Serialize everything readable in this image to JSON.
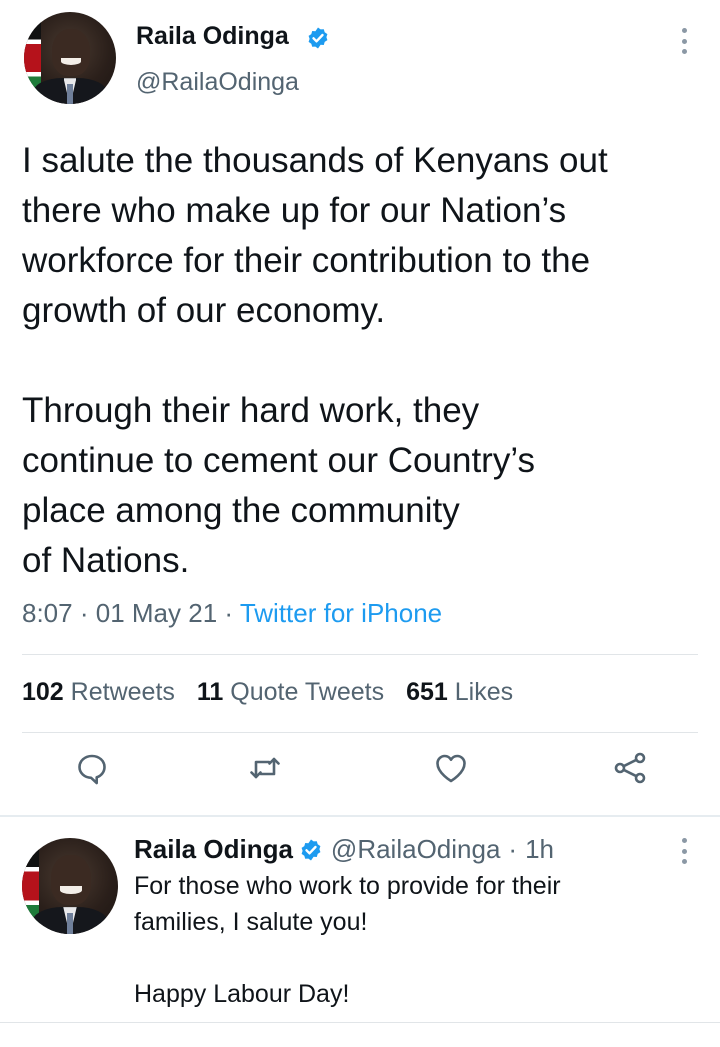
{
  "main_tweet": {
    "author_name": "Raila Odinga",
    "author_handle": "@RailaOdinga",
    "text": "I salute the thousands of Kenyans out\nthere who make up for our Nation’s\nworkforce for their contribution to the\ngrowth of our economy.\n\nThrough their hard work, they\ncontinue to cement our Country’s\nplace among the community\nof Nations.",
    "time": "8:07",
    "date": "01 May 21",
    "separator": "·",
    "source": "Twitter for iPhone",
    "stats": {
      "retweets_count": "102",
      "retweets_label": "Retweets",
      "quotes_count": "11",
      "quotes_label": "Quote Tweets",
      "likes_count": "651",
      "likes_label": "Likes"
    },
    "actions": [
      "reply-icon",
      "retweet-icon",
      "like-icon",
      "share-icon"
    ]
  },
  "reply_tweet": {
    "author_name": "Raila Odinga",
    "author_handle": "@RailaOdinga",
    "separator": "·",
    "age": "1h",
    "text": "For those who work to provide for their\nfamilies, I salute you!\n\nHappy Labour Day!"
  },
  "colors": {
    "accent": "#1d9bf0",
    "secondary_text": "#536471",
    "primary_text": "#0f1419",
    "divider": "#e1e5e8"
  }
}
